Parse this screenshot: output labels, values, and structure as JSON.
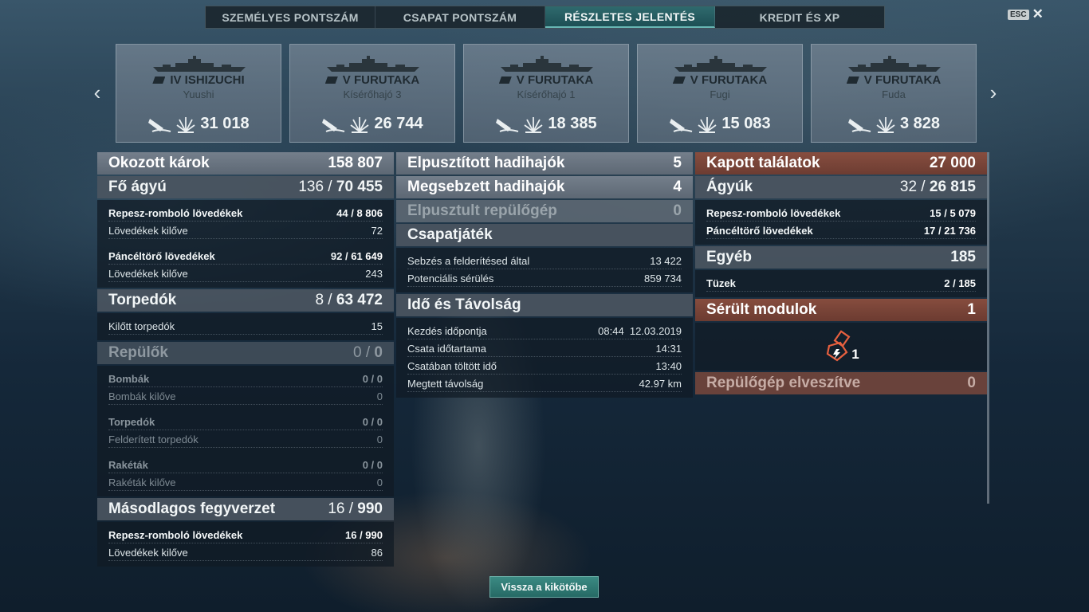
{
  "tabs": [
    "SZEMÉLYES PONTSZÁM",
    "CSAPAT PONTSZÁM",
    "RÉSZLETES JELENTÉS",
    "KREDIT ÉS XP"
  ],
  "active_tab": 2,
  "esc": {
    "key": "ESC",
    "close": "✕"
  },
  "nav": {
    "prev": "‹",
    "next": "›"
  },
  "ships": [
    {
      "name": "IV ISHIZUCHI",
      "player": "Yuushi",
      "damage": "31 018"
    },
    {
      "name": "V FURUTAKA",
      "player": "Kísérőhajó 3",
      "damage": "26 744"
    },
    {
      "name": "V FURUTAKA",
      "player": "Kísérőhajó 1",
      "damage": "18 385"
    },
    {
      "name": "V FURUTAKA",
      "player": "Fugi",
      "damage": "15 083"
    },
    {
      "name": "V FURUTAKA",
      "player": "Fuda",
      "damage": "3 828"
    }
  ],
  "left": {
    "damage_caused": {
      "label": "Okozott károk",
      "value": "158 807"
    },
    "main_guns": {
      "label": "Fő ágyú",
      "hits": "136",
      "value": "70 455"
    },
    "he": {
      "label": "Repesz-romboló lövedékek",
      "hits": "44",
      "value": "8 806"
    },
    "he_fired": {
      "label": "Lövedékek kilőve",
      "value": "72"
    },
    "ap": {
      "label": "Páncéltörő lövedékek",
      "hits": "92",
      "value": "61 649"
    },
    "ap_fired": {
      "label": "Lövedékek kilőve",
      "value": "243"
    },
    "torpedoes": {
      "label": "Torpedók",
      "hits": "8",
      "value": "63 472"
    },
    "torps_fired": {
      "label": "Kilőtt torpedók",
      "value": "15"
    },
    "aircraft": {
      "label": "Repülők",
      "hits": "0",
      "value": "0"
    },
    "bombs": {
      "label": "Bombák",
      "hits": "0",
      "value": "0"
    },
    "bombs_dropped": {
      "label": "Bombák kilőve",
      "value": "0"
    },
    "air_torps": {
      "label": "Torpedók",
      "hits": "0",
      "value": "0"
    },
    "spotted_torps": {
      "label": "Felderített torpedók",
      "value": "0"
    },
    "rockets": {
      "label": "Rakéták",
      "hits": "0",
      "value": "0"
    },
    "rockets_fired": {
      "label": "Rakéták kilőve",
      "value": "0"
    },
    "secondary": {
      "label": "Másodlagos fegyverzet",
      "hits": "16",
      "value": "990"
    },
    "sec_he": {
      "label": "Repesz-romboló lövedékek",
      "hits": "16",
      "value": "990"
    },
    "sec_fired": {
      "label": "Lövedékek kilőve",
      "value": "86"
    }
  },
  "middle": {
    "ships_destroyed": {
      "label": "Elpusztított hadihajók",
      "value": "5"
    },
    "ships_damaged": {
      "label": "Megsebzett hadihajók",
      "value": "4"
    },
    "planes_destroyed": {
      "label": "Elpusztult repülőgép",
      "value": "0"
    },
    "teamplay": {
      "label": "Csapatjáték"
    },
    "spotting_damage": {
      "label": "Sebzés a felderítésed által",
      "value": "13 422"
    },
    "potential_damage": {
      "label": "Potenciális sérülés",
      "value": "859 734"
    },
    "time_distance": {
      "label": "Idő és Távolság"
    },
    "start_time": {
      "label": "Kezdés időpontja",
      "value": "08:44  12.03.2019"
    },
    "battle_duration": {
      "label": "Csata időtartama",
      "value": "14:31"
    },
    "time_in_battle": {
      "label": "Csatában töltött idő",
      "value": "13:40"
    },
    "distance": {
      "label": "Megtett távolság",
      "value": "42.97 km"
    }
  },
  "right": {
    "hits_received": {
      "label": "Kapott találatok",
      "value": "27 000"
    },
    "guns": {
      "label": "Ágyúk",
      "hits": "32",
      "value": "26 815"
    },
    "he": {
      "label": "Repesz-romboló lövedékek",
      "hits": "15",
      "value": "5 079"
    },
    "ap": {
      "label": "Páncéltörő lövedékek",
      "hits": "17",
      "value": "21 736"
    },
    "other": {
      "label": "Egyéb",
      "value": "185"
    },
    "fires": {
      "label": "Tüzek",
      "hits": "2",
      "value": "185"
    },
    "damaged_modules": {
      "label": "Sérült modulok",
      "value": "1"
    },
    "module_count": "1",
    "module_icon": "damaged-module-icon",
    "planes_lost": {
      "label": "Repülőgép elveszítve",
      "value": "0"
    }
  },
  "back_button": "Vissza a kikötőbe",
  "colors": {
    "accent": "#2f6a6e",
    "received": "#8c4e3e",
    "button": "#2f7a74"
  }
}
